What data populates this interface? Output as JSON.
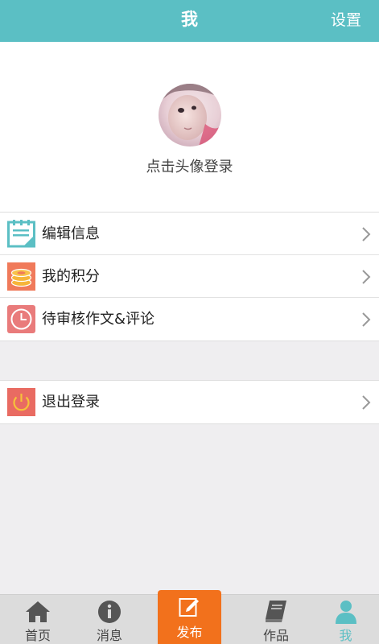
{
  "header": {
    "title": "我",
    "settings_label": "设置"
  },
  "profile": {
    "login_hint": "点击头像登录"
  },
  "menu": {
    "items": [
      {
        "label": "编辑信息",
        "icon": "edit-notepad-icon",
        "color": "#5bbfc4"
      },
      {
        "label": "我的积分",
        "icon": "coins-stack-icon",
        "color": "#f07a5a"
      },
      {
        "label": "待审核作文&评论",
        "icon": "clock-icon",
        "color": "#e97b7b"
      }
    ],
    "logout": {
      "label": "退出登录",
      "icon": "power-icon",
      "color": "#e96b62"
    }
  },
  "tabbar": {
    "tabs": [
      {
        "label": "首页",
        "icon": "home-icon"
      },
      {
        "label": "消息",
        "icon": "info-icon"
      },
      {
        "label": "发布",
        "icon": "compose-icon"
      },
      {
        "label": "作品",
        "icon": "book-icon"
      },
      {
        "label": "我",
        "icon": "person-icon",
        "active": true
      }
    ]
  },
  "colors": {
    "accent": "#5bbfc4",
    "publish": "#f2711c",
    "background": "#efeef0"
  }
}
